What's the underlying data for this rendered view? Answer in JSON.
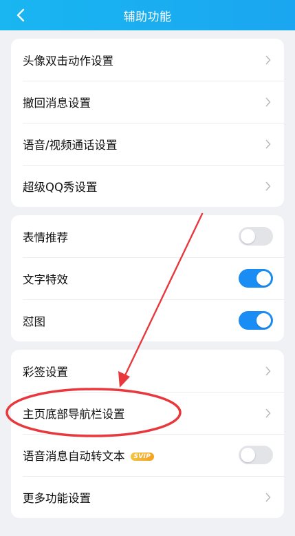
{
  "header": {
    "title": "辅助功能"
  },
  "group1": [
    {
      "label": "头像双击动作设置"
    },
    {
      "label": "撤回消息设置"
    },
    {
      "label": "语音/视频通话设置"
    },
    {
      "label": "超级QQ秀设置"
    }
  ],
  "group2": [
    {
      "label": "表情推荐",
      "toggle": "off"
    },
    {
      "label": "文字特效",
      "toggle": "on"
    },
    {
      "label": "怼图",
      "toggle": "on"
    }
  ],
  "group3": [
    {
      "label": "彩签设置"
    },
    {
      "label": "主页底部导航栏设置"
    },
    {
      "label": "语音消息自动转文本",
      "badge": "SVIP",
      "toggle": "off"
    },
    {
      "label": "更多功能设置"
    }
  ],
  "colors": {
    "header": "#19b6f1",
    "toggle_on": "#1a8df5",
    "annotation": "#e8383d"
  },
  "icons": {
    "back": "back-arrow-icon",
    "chevron": "chevron-right-icon"
  }
}
